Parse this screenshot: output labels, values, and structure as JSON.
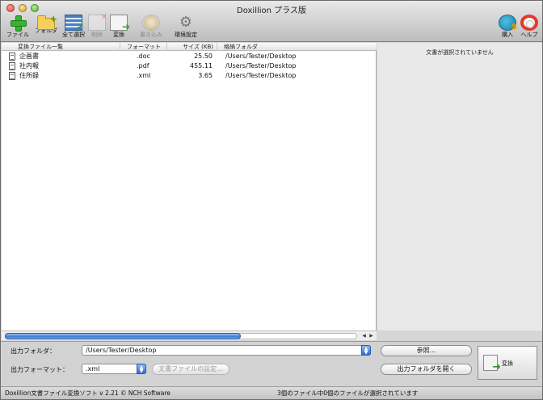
{
  "window": {
    "title": "Doxillion プラス版"
  },
  "toolbar": {
    "items": [
      {
        "label": "ファイル",
        "icon": "add-file-icon"
      },
      {
        "label": "フォルダ",
        "icon": "add-folder-icon"
      },
      {
        "label": "全て選択",
        "icon": "select-all-icon"
      },
      {
        "label": "削除",
        "icon": "delete-icon",
        "disabled": true
      },
      {
        "label": "変換",
        "icon": "convert-icon"
      },
      {
        "label": "書き込み",
        "icon": "burn-disc-icon",
        "disabled": true
      },
      {
        "label": "環境設定",
        "icon": "gear-icon"
      },
      {
        "label": "購入",
        "icon": "buy-icon"
      },
      {
        "label": "ヘルプ",
        "icon": "help-lifebuoy-icon"
      }
    ]
  },
  "file_list": {
    "columns": [
      "変換ファイル一覧",
      "フォーマット",
      "サイズ (KB)",
      "格納フォルダ"
    ],
    "rows": [
      {
        "name": "企画書",
        "format": ".doc",
        "size": "25.50",
        "folder": "/Users/Tester/Desktop"
      },
      {
        "name": "社内報",
        "format": ".pdf",
        "size": "455.11",
        "folder": "/Users/Tester/Desktop"
      },
      {
        "name": "住所録",
        "format": ".xml",
        "size": "3.65",
        "folder": "/Users/Tester/Desktop"
      }
    ]
  },
  "preview": {
    "message": "文書が選択されていません"
  },
  "output": {
    "folder_label": "出力フォルダ：",
    "folder_value": "/Users/Tester/Desktop",
    "format_label": "出力フォーマット：",
    "format_value": ".xml",
    "doc_settings_label": "文書ファイルの設定...",
    "browse_label": "参照...",
    "open_folder_label": "出力フォルダを開く",
    "convert_label": "変換"
  },
  "status": {
    "left": "Doxillion文書ファイル変換ソフト v 2.21 © NCH Software",
    "center": "3個のファイル中0個のファイルが選択されています"
  },
  "scroll": {
    "horizontal_fraction": 0.67
  }
}
